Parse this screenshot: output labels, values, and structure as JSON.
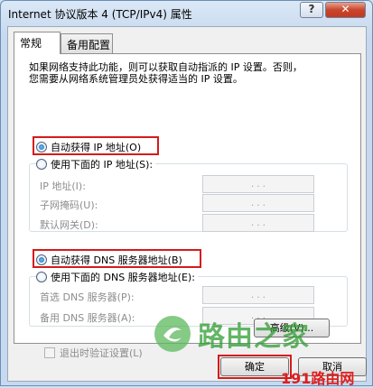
{
  "window": {
    "title": "Internet 协议版本 4 (TCP/IPv4) 属性",
    "help_label": "?",
    "close_label": "✕"
  },
  "tabs": [
    {
      "label": "常规",
      "active": true
    },
    {
      "label": "备用配置",
      "active": false
    }
  ],
  "description": {
    "line1": "如果网络支持此功能，则可以获取自动指派的 IP 设置。否则，",
    "line2": "您需要从网络系统管理员处获得适当的 IP 设置。"
  },
  "ip_section": {
    "auto_label": "自动获得 IP 地址(O)",
    "manual_label": "使用下面的 IP 地址(S):",
    "auto_selected": true,
    "fields": [
      {
        "label": "IP 地址(I):",
        "value": ".  .  ."
      },
      {
        "label": "子网掩码(U):",
        "value": ".  .  ."
      },
      {
        "label": "默认网关(D):",
        "value": ".  .  ."
      }
    ]
  },
  "dns_section": {
    "auto_label": "自动获得 DNS 服务器地址(B)",
    "manual_label": "使用下面的 DNS 服务器地址(E):",
    "auto_selected": true,
    "fields": [
      {
        "label": "首选 DNS 服务器(P):",
        "value": ".  .  ."
      },
      {
        "label": "备用 DNS 服务器(A):",
        "value": ".  .  ."
      }
    ]
  },
  "validate_on_exit_label": "退出时验证设置(L)",
  "advanced_label": "高级(V)...",
  "ok_label": "确定",
  "cancel_label": "取消",
  "watermark": {
    "logo_text": "路由之家",
    "brand_text": "191路由网"
  },
  "colors": {
    "highlight_box": "#d51b1b",
    "brand": "#e01e1e",
    "logo_green": "#2f9d32"
  }
}
